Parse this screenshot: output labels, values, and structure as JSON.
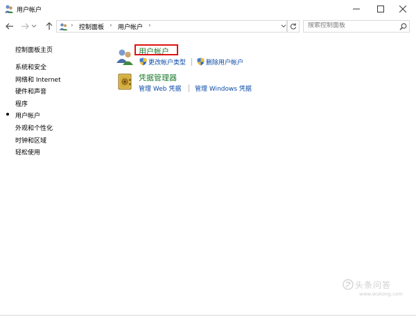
{
  "window": {
    "title": "用户帐户"
  },
  "address_bar": {
    "breadcrumbs": [
      "控制面板",
      "用户帐户"
    ],
    "separator": "›"
  },
  "search": {
    "placeholder": "搜索控制面板"
  },
  "left_nav": {
    "items": [
      {
        "label": "控制面板主页",
        "active": false
      },
      {
        "label": "系统和安全",
        "active": false
      },
      {
        "label": "网络和 Internet",
        "active": false
      },
      {
        "label": "硬件和声音",
        "active": false
      },
      {
        "label": "程序",
        "active": false
      },
      {
        "label": "用户帐户",
        "active": true
      },
      {
        "label": "外观和个性化",
        "active": false
      },
      {
        "label": "时钟和区域",
        "active": false
      },
      {
        "label": "轻松使用",
        "active": false
      }
    ]
  },
  "main": {
    "user_accounts": {
      "title": "用户帐户",
      "links": [
        "更改帐户类型",
        "删除用户帐户"
      ]
    },
    "credential_manager": {
      "title": "凭据管理器",
      "links": [
        "管理 Web 凭据",
        "管理 Windows 凭据"
      ]
    }
  },
  "watermark": {
    "text": "头条问答",
    "url": "www.wukong.com"
  },
  "colors": {
    "category_title": "#1e7a2e",
    "link": "#0a4aa8",
    "highlight_box": "#dd1111"
  },
  "icons": {
    "title": "user-accounts-icon",
    "minimize": "minimize-icon",
    "maximize": "maximize-icon",
    "close": "close-icon",
    "back": "back-arrow-icon",
    "forward": "forward-arrow-icon",
    "recent": "chevron-down-icon",
    "up": "up-arrow-icon",
    "refresh": "refresh-icon",
    "search": "search-icon",
    "shield": "uac-shield-icon"
  }
}
